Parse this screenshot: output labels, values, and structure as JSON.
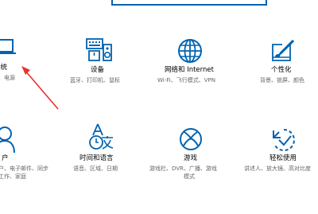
{
  "tiles": {
    "system": {
      "title": "系统",
      "desc": "显示、声音、通知、电源",
      "desc_line1": "、电源",
      "icon": "laptop-icon"
    },
    "devices": {
      "title": "设备",
      "desc": "蓝牙、打印机、鼠标",
      "icon": "keyboard-speaker-icon"
    },
    "network": {
      "title": "网络和 Internet",
      "desc": "Wi-Fi、飞行模式、VPN",
      "icon": "globe-icon"
    },
    "personal": {
      "title": "个性化",
      "desc": "背景、锁屏、颜色",
      "icon": "paint-tablet-icon"
    },
    "accounts": {
      "title": "户",
      "desc_line1": "户、电子邮件、同步",
      "desc_line2": "工作、家庭",
      "icon": "person-icon"
    },
    "time": {
      "title": "时间和语言",
      "desc": "语音、区域、日期",
      "icon": "time-language-icon"
    },
    "gaming": {
      "title": "游戏",
      "desc_line1": "游戏栏、DVR、广播、游戏",
      "desc_line2": "模式",
      "icon": "xbox-icon"
    },
    "ease": {
      "title": "轻松使用",
      "desc": "讲述人、放大镜、高对比度",
      "icon": "ease-of-access-icon"
    }
  },
  "colors": {
    "accent": "#0063b1",
    "arrow": "#e8322e"
  }
}
